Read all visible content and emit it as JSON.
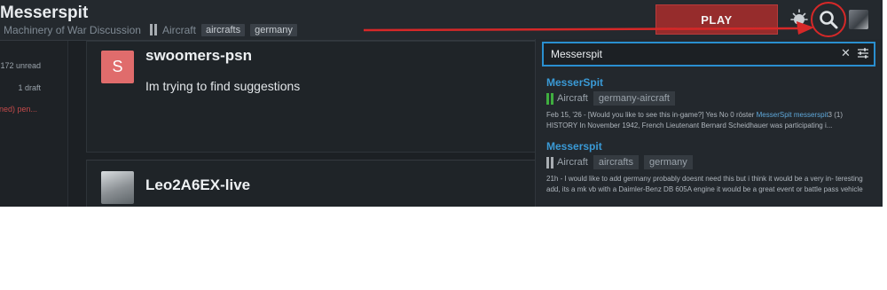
{
  "header": {
    "title": "Messerspit",
    "breadcrumb": {
      "category": "Machinery of War Discussion",
      "subcategory": "Aircraft",
      "tags": [
        "aircrafts",
        "germany"
      ]
    },
    "play_label": "PLAY"
  },
  "sidebar": {
    "unread": "172 unread",
    "draft": "1 draft",
    "pending": "ned) pen..."
  },
  "posts": [
    {
      "username": "swoomers-psn",
      "avatar_letter": "S",
      "body": "Im trying to find suggestions"
    },
    {
      "username": "Leo2A6EX-live"
    }
  ],
  "search": {
    "query": "Messerspit",
    "results": [
      {
        "title": "MesserSpit",
        "category": "Aircraft",
        "category_color": "#3fae3f",
        "tags": [
          "germany-aircraft"
        ],
        "excerpt_before": "Feb 15, '26 - [Would you like to see this in-game?] Yes No 0 röster ",
        "excerpt_highlight": "MesserSpit messerspit",
        "excerpt_after": "3 (1) HISTORY In November 1942, French Lieutenant Bernard Scheidhauer was participating i..."
      },
      {
        "title": "Messerspit",
        "category": "Aircraft",
        "category_color": "#a8adb2",
        "tags": [
          "aircrafts",
          "germany"
        ],
        "excerpt": "21h - I would like to add germany probably doesnt need this but i think it would be a very in- teresting add, its a mk vb with a Daimler-Benz DB 605A engine it would be a great event or battle pass vehicle"
      }
    ]
  },
  "colors": {
    "accent_link": "#3a9ad6",
    "annotation_red": "#d62828",
    "play_button": "#962c2c"
  },
  "icons": {
    "theme": "sun-icon",
    "search": "magnifier-icon",
    "clear": "close-icon",
    "options": "sliders-icon"
  }
}
